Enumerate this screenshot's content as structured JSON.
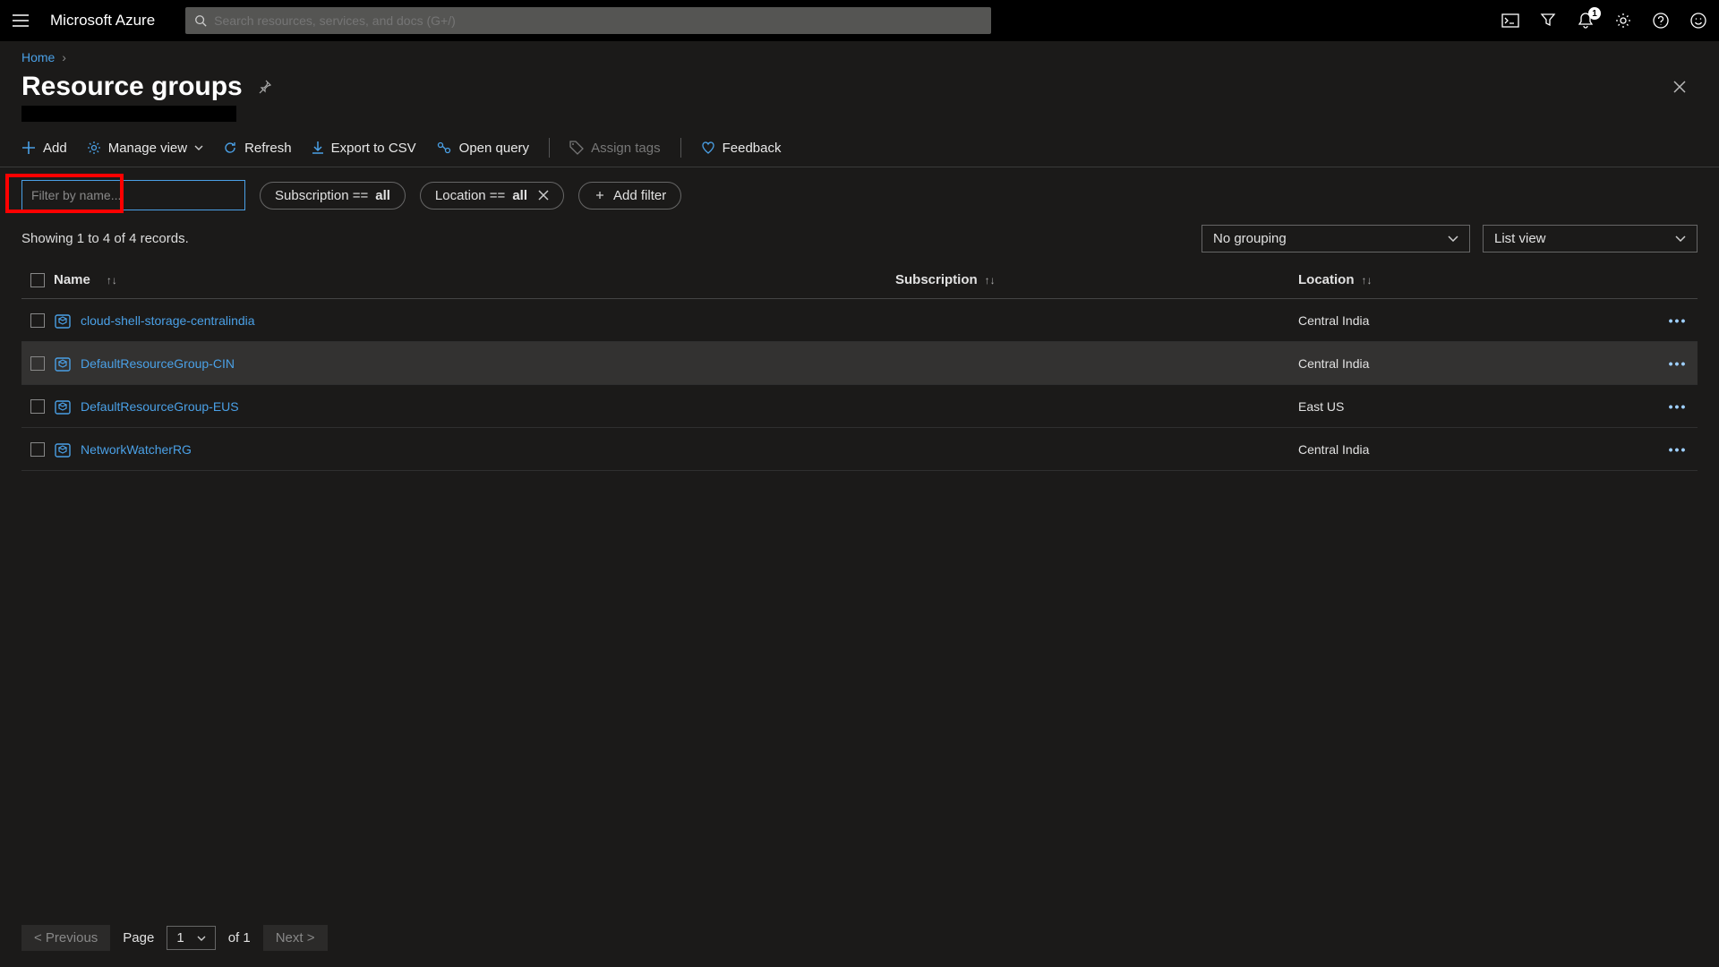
{
  "brand": "Microsoft Azure",
  "search": {
    "placeholder": "Search resources, services, and docs (G+/)"
  },
  "notifications": {
    "count": "1"
  },
  "breadcrumb": {
    "home": "Home"
  },
  "page": {
    "title": "Resource groups"
  },
  "toolbar": {
    "add": "Add",
    "manage_view": "Manage view",
    "refresh": "Refresh",
    "export_csv": "Export to CSV",
    "open_query": "Open query",
    "assign_tags": "Assign tags",
    "feedback": "Feedback"
  },
  "filters": {
    "name_placeholder": "Filter by name...",
    "subscription_label": "Subscription == ",
    "subscription_value": "all",
    "location_label": "Location == ",
    "location_value": "all",
    "add_filter": "Add filter"
  },
  "records": {
    "text": "Showing 1 to 4 of 4 records."
  },
  "controls": {
    "grouping": "No grouping",
    "view": "List view"
  },
  "columns": {
    "name": "Name",
    "subscription": "Subscription",
    "location": "Location"
  },
  "rows": [
    {
      "name": "cloud-shell-storage-centralindia",
      "location": "Central India"
    },
    {
      "name": "DefaultResourceGroup-CIN",
      "location": "Central India"
    },
    {
      "name": "DefaultResourceGroup-EUS",
      "location": "East US"
    },
    {
      "name": "NetworkWatcherRG",
      "location": "Central India"
    }
  ],
  "pagination": {
    "previous": "< Previous",
    "page_label": "Page",
    "page_value": "1",
    "of_label": "of 1",
    "next": "Next >"
  }
}
